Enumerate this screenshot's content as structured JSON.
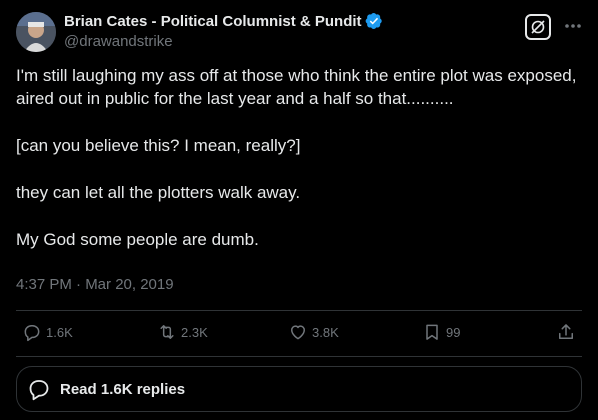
{
  "author": {
    "display_name": "Brian Cates - Political Columnist & Pundit",
    "handle": "@drawandstrike",
    "verified": true
  },
  "tweet": {
    "paragraphs": [
      "I'm still laughing my ass off at those who think the entire plot was exposed, aired out in public for the last year and a half so that..........",
      "[can you believe this? I mean, really?]",
      "they can let all the plotters walk away.",
      "My God some people are dumb."
    ],
    "timestamp": "4:37 PM · Mar 20, 2019"
  },
  "actions": {
    "replies": "1.6K",
    "reposts": "2.3K",
    "likes": "3.8K",
    "bookmarks": "99"
  },
  "read_replies_label": "Read 1.6K replies",
  "colors": {
    "background": "#000000",
    "text": "#e7e9ea",
    "muted": "#71767b",
    "border": "#2f3336",
    "verified": "#1d9bf0"
  },
  "icons": [
    "verified-badge-icon",
    "grok-icon",
    "more-icon",
    "reply-icon",
    "repost-icon",
    "like-icon",
    "bookmark-icon",
    "share-icon",
    "replies-bubble-icon"
  ]
}
